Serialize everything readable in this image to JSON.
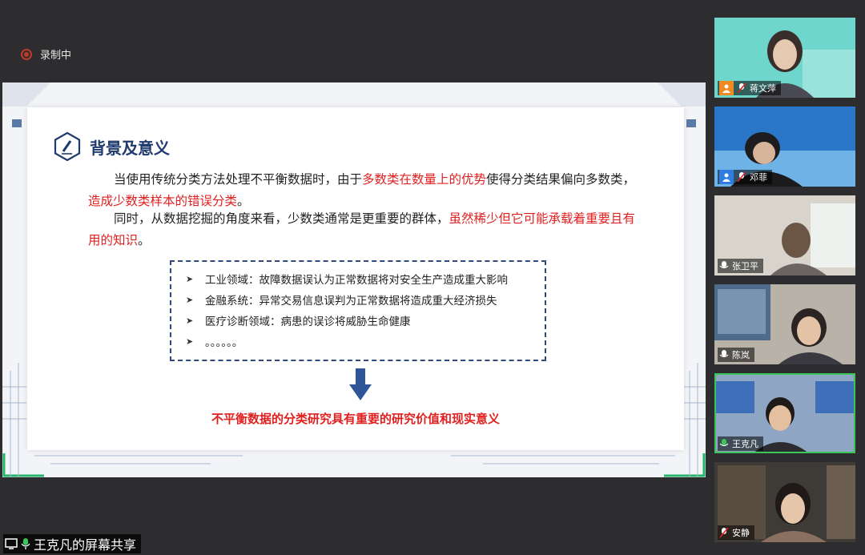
{
  "recording": {
    "label": "录制中"
  },
  "slide": {
    "heading": "背景及意义",
    "para1": {
      "a": "当使用传统分类方法处理不平衡数据时，由于",
      "b": "多数类在数量上的优势",
      "c": "使得分类结果偏向多数类，",
      "d": "造成少数类样本的错误分类",
      "e": "。"
    },
    "para2": {
      "a": "同时，从数据挖掘的角度来看，少数类通常是更重要的群体，",
      "b": "虽然稀少但它可能承载着重要且有用的知识",
      "c": "。"
    },
    "bullets": [
      "工业领域：故障数据误认为正常数据将对安全生产造成重大影响",
      "金融系统：异常交易信息误判为正常数据将造成重大经济损失",
      "医疗诊断领域：病患的误诊将威胁生命健康",
      "。。。。。。"
    ],
    "conclusion": "不平衡数据的分类研究具有重要的研究价值和现实意义"
  },
  "share": {
    "label": "王克凡的屏幕共享"
  },
  "participants": [
    {
      "name": "蒋文萍",
      "tile_bg": "#6ed6cc",
      "avatar_color": "#f08a24"
    },
    {
      "name": "邓菲",
      "tile_bg": "#2a76c9",
      "avatar_color": "#2f7de1"
    },
    {
      "name": "张卫平",
      "tile_bg": "#d8d4cc",
      "avatar_color": ""
    },
    {
      "name": "陈岚",
      "tile_bg": "#7b8ea3",
      "avatar_color": ""
    },
    {
      "name": "王克凡",
      "tile_bg": "#5c8ed4",
      "avatar_color": ""
    },
    {
      "name": "安静",
      "tile_bg": "#3e3a36",
      "avatar_color": ""
    }
  ],
  "colors": {
    "accent_red": "#e02020",
    "heading_blue": "#1f3b6e",
    "speaking_green": "#3cc65a"
  }
}
